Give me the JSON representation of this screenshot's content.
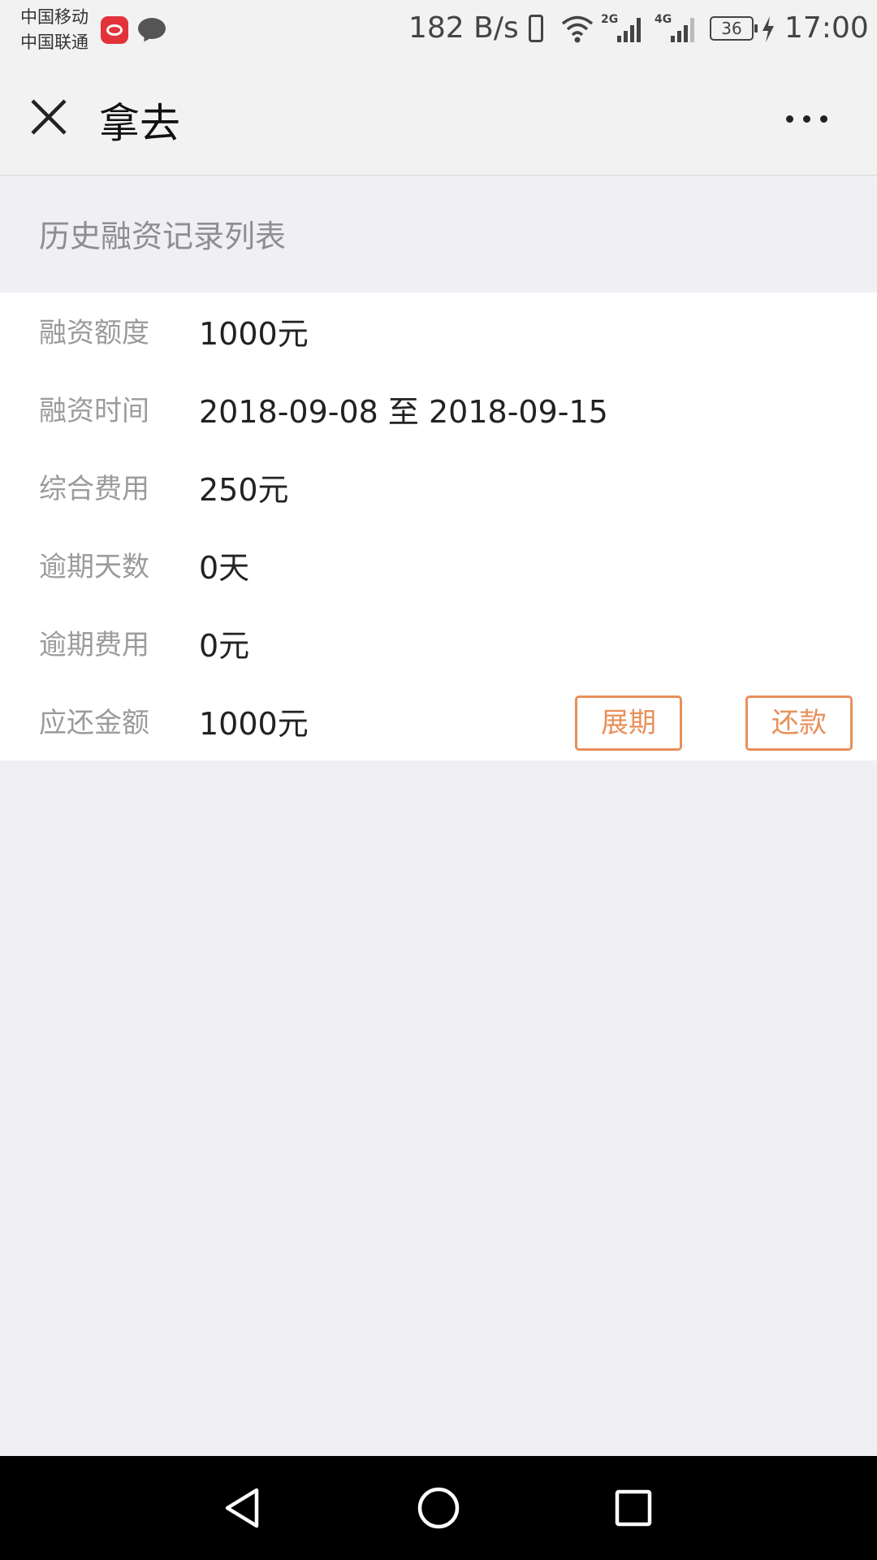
{
  "status_bar": {
    "carrier_1": "中国移动",
    "carrier_2": "中国联通",
    "net_speed": "182 B/s",
    "signal_1_label": "2G",
    "signal_2_label": "4G",
    "battery_level": "36",
    "time": "17:00"
  },
  "nav": {
    "title": "拿去"
  },
  "section": {
    "title": "历史融资记录列表"
  },
  "record": {
    "rows": [
      {
        "label": "融资额度",
        "value": "1000元"
      },
      {
        "label": "融资时间",
        "value": "2018-09-08 至 2018-09-15"
      },
      {
        "label": "综合费用",
        "value": "250元"
      },
      {
        "label": "逾期天数",
        "value": "0天"
      },
      {
        "label": "逾期费用",
        "value": "0元"
      },
      {
        "label": "应还金额",
        "value": "1000元"
      }
    ],
    "extend_label": "展期",
    "repay_label": "还款"
  },
  "colors": {
    "accent": "#e8905a",
    "background": "#efeff4",
    "card": "#ffffff",
    "label": "#9b9b9b"
  },
  "icons": {
    "close": "close-icon",
    "more": "more-dots-icon",
    "back": "back-triangle-icon",
    "home": "home-circle-icon",
    "recent": "recent-square-icon"
  }
}
